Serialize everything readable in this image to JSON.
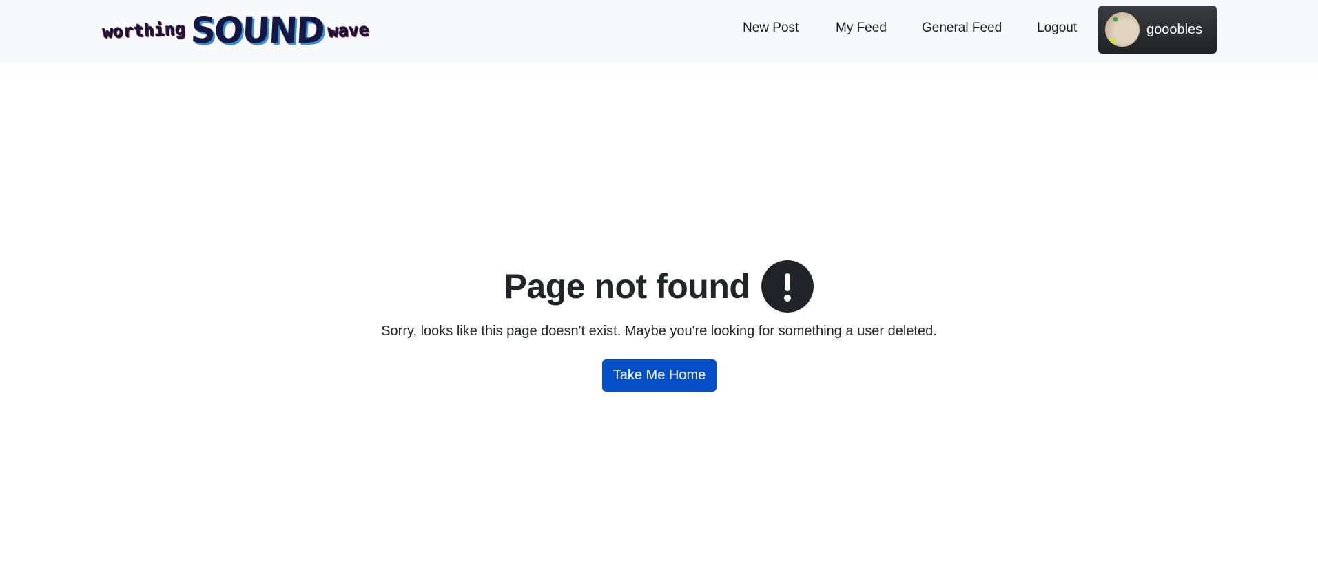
{
  "navbar": {
    "brand": {
      "prefix": "worthing",
      "main": "SOUND",
      "suffix": "wave"
    },
    "links": [
      {
        "label": "New Post"
      },
      {
        "label": "My Feed"
      },
      {
        "label": "General Feed"
      },
      {
        "label": "Logout"
      }
    ],
    "user": {
      "username": "gooobles"
    }
  },
  "main": {
    "title": "Page not found",
    "icon": "exclamation-circle-icon",
    "message": "Sorry, looks like this page doesn't exist. Maybe you're looking for something a user deleted.",
    "button_label": "Take Me Home"
  },
  "colors": {
    "navbar_bg": "#f8f9fa",
    "primary_button": "#0550c8",
    "user_button": "#212529",
    "text": "#212529"
  }
}
